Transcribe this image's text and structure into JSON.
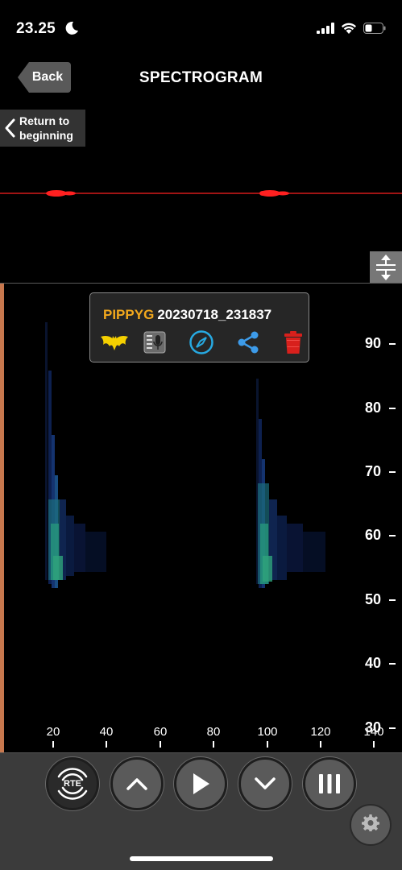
{
  "status": {
    "time": "23.25"
  },
  "nav": {
    "back_label": "Back",
    "title": "SPECTROGRAM",
    "return_label": "Return to\nbeginning"
  },
  "popup": {
    "species": "PIPPYG",
    "recording": "20230718_231837",
    "icons": [
      "bat-icon",
      "microphone-info-icon",
      "compass-icon",
      "share-icon",
      "trash-icon"
    ]
  },
  "spectrogram": {
    "y_ticks": [
      "90",
      "80",
      "70",
      "60",
      "50",
      "40",
      "30"
    ],
    "x_ticks": [
      "20",
      "40",
      "60",
      "80",
      "100",
      "120",
      "140"
    ]
  },
  "toolbar": {
    "rte_label": "RTE",
    "buttons": [
      "rte-button",
      "scroll-up-button",
      "play-button",
      "scroll-down-button",
      "menu-button"
    ]
  },
  "colors": {
    "species": "#f2a81d",
    "waveform": "#ff2020",
    "accent_edge": "#c8784e",
    "compass": "#27a9e1",
    "share": "#3d9be9",
    "trash": "#d8201c",
    "bat": "#f5d000"
  }
}
